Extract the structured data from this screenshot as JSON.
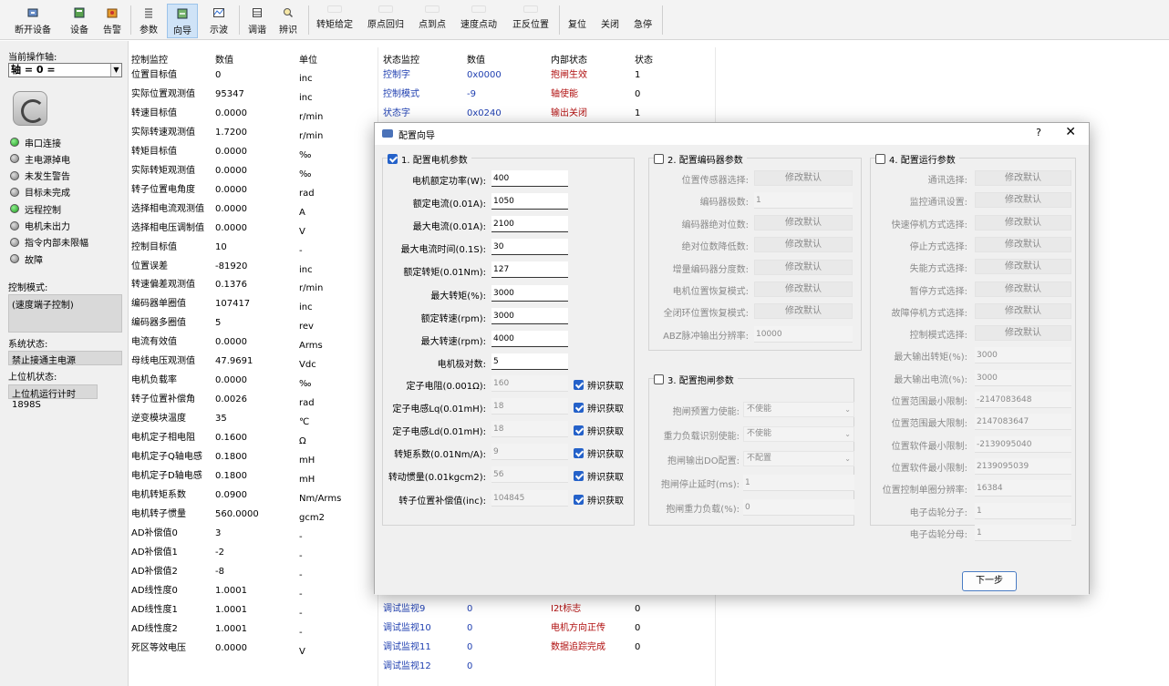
{
  "toolbar": {
    "items": [
      {
        "label": "断开设备"
      },
      {
        "label": "设备"
      },
      {
        "label": "告警"
      },
      {
        "label": "参数"
      },
      {
        "label": "向导"
      },
      {
        "label": "示波"
      },
      {
        "label": "调谐"
      },
      {
        "label": "辨识"
      },
      {
        "label": "转矩给定"
      },
      {
        "label": "原点回归"
      },
      {
        "label": "点到点"
      },
      {
        "label": "速度点动"
      },
      {
        "label": "正反位置"
      },
      {
        "label": "复位"
      },
      {
        "label": "关闭"
      },
      {
        "label": "急停"
      }
    ]
  },
  "left": {
    "current_axis_label": "当前操作轴:",
    "axis_value": "轴 = 0 =",
    "status": [
      {
        "label": "串口连接",
        "led": "green"
      },
      {
        "label": "主电源掉电",
        "led": "grey"
      },
      {
        "label": "未发生警告",
        "led": "grey"
      },
      {
        "label": "目标未完成",
        "led": "grey"
      },
      {
        "label": "远程控制",
        "led": "green"
      },
      {
        "label": "电机未出力",
        "led": "grey"
      },
      {
        "label": "指令内部未限幅",
        "led": "grey"
      },
      {
        "label": "故障",
        "led": "grey"
      }
    ],
    "control_mode_label": "控制模式:",
    "control_mode_value": "(速度端子控制)",
    "system_status_label": "系统状态:",
    "system_status_value": "禁止接通主电源",
    "host_status_label": "上位机状态:",
    "host_status_value": "上位机运行计时1898S"
  },
  "table1": {
    "headers": [
      "控制监控",
      "数值",
      "单位"
    ],
    "rows": [
      [
        "位置目标值",
        "0",
        "inc"
      ],
      [
        "实际位置观测值",
        "95347",
        "inc"
      ],
      [
        "转速目标值",
        "0.0000",
        "r/min"
      ],
      [
        "实际转速观测值",
        "1.7200",
        "r/min"
      ],
      [
        "转矩目标值",
        "0.0000",
        "‰"
      ],
      [
        "实际转矩观测值",
        "0.0000",
        "‰"
      ],
      [
        "转子位置电角度",
        "0.0000",
        "rad"
      ],
      [
        "选择相电流观测值",
        "0.0000",
        "A"
      ],
      [
        "选择相电压调制值",
        "0.0000",
        "V"
      ],
      [
        "控制目标值",
        "10",
        "-"
      ],
      [
        "位置误差",
        "-81920",
        "inc"
      ],
      [
        "转速偏差观测值",
        "0.1376",
        "r/min"
      ],
      [
        "编码器单圈值",
        "107417",
        "inc"
      ],
      [
        "编码器多圈值",
        "5",
        "rev"
      ],
      [
        "电流有效值",
        "0.0000",
        "Arms"
      ],
      [
        "母线电压观测值",
        "47.9691",
        "Vdc"
      ],
      [
        "电机负载率",
        "0.0000",
        "‰"
      ],
      [
        "转子位置补偿角",
        "0.0026",
        "rad"
      ],
      [
        "逆变模块温度",
        "35",
        "℃"
      ],
      [
        "电机定子相电阻",
        "0.1600",
        "Ω"
      ],
      [
        "电机定子Q轴电感",
        "0.1800",
        "mH"
      ],
      [
        "电机定子D轴电感",
        "0.1800",
        "mH"
      ],
      [
        "电机转矩系数",
        "0.0900",
        "Nm/Arms"
      ],
      [
        "电机转子惯量",
        "560.0000",
        "gcm2"
      ],
      [
        "AD补偿值0",
        "3",
        "-"
      ],
      [
        "AD补偿值1",
        "-2",
        "-"
      ],
      [
        "AD补偿值2",
        "-8",
        "-"
      ],
      [
        "AD线性度0",
        "1.0001",
        "-"
      ],
      [
        "AD线性度1",
        "1.0001",
        "-"
      ],
      [
        "AD线性度2",
        "1.0001",
        "-"
      ],
      [
        "死区等效电压",
        "0.0000",
        "V"
      ]
    ]
  },
  "table2": {
    "headers": [
      "状态监控",
      "数值",
      "内部状态",
      "状态"
    ],
    "rows_top": [
      [
        "控制字",
        "0x0000",
        "抱闸生效",
        "1"
      ],
      [
        "控制模式",
        "-9",
        "轴使能",
        "0"
      ],
      [
        "状态字",
        "0x0240",
        "输出关闭",
        "1"
      ]
    ],
    "rows_bottom": [
      [
        "调试监视9",
        "0",
        "I2t标志",
        "0"
      ],
      [
        "调试监视10",
        "0",
        "电机方向正传",
        "0"
      ],
      [
        "调试监视11",
        "0",
        "数据追踪完成",
        "0"
      ],
      [
        "调试监视12",
        "0",
        "",
        ""
      ]
    ]
  },
  "dialog": {
    "title": "配置向导",
    "help": "?",
    "close": "✕",
    "g1": {
      "title": "1. 配置电机参数",
      "fields": [
        {
          "label": "电机额定功率(W):",
          "value": "400"
        },
        {
          "label": "额定电流(0.01A):",
          "value": "1050"
        },
        {
          "label": "最大电流(0.01A):",
          "value": "2100"
        },
        {
          "label": "最大电流时间(0.1S):",
          "value": "30"
        },
        {
          "label": "额定转矩(0.01Nm):",
          "value": "127"
        },
        {
          "label": "最大转矩(%):",
          "value": "3000"
        },
        {
          "label": "额定转速(rpm):",
          "value": "3000"
        },
        {
          "label": "最大转速(rpm):",
          "value": "4000"
        },
        {
          "label": "电机极对数:",
          "value": "5"
        }
      ],
      "id_fields": [
        {
          "label": "定子电阻(0.001Ω):",
          "value": "160"
        },
        {
          "label": "定子电感Lq(0.01mH):",
          "value": "18"
        },
        {
          "label": "定子电感Ld(0.01mH):",
          "value": "18"
        },
        {
          "label": "转矩系数(0.01Nm/A):",
          "value": "9"
        },
        {
          "label": "转动惯量(0.01kgcm2):",
          "value": "56"
        },
        {
          "label": "转子位置补偿值(inc):",
          "value": "104845"
        }
      ],
      "auto_id_label": "辨识获取"
    },
    "g2": {
      "title": "2. 配置编码器参数",
      "rows": [
        {
          "label": "位置传感器选择:",
          "kind": "btn",
          "value": "修改默认"
        },
        {
          "label": "编码器极数:",
          "kind": "inp",
          "value": "1"
        },
        {
          "label": "编码器绝对位数:",
          "kind": "btn",
          "value": "修改默认"
        },
        {
          "label": "绝对位数降低数:",
          "kind": "btn",
          "value": "修改默认"
        },
        {
          "label": "增量编码器分度数:",
          "kind": "btn",
          "value": "修改默认"
        },
        {
          "label": "电机位置恢复模式:",
          "kind": "btn",
          "value": "修改默认"
        },
        {
          "label": "全闭环位置恢复模式:",
          "kind": "btn",
          "value": "修改默认"
        },
        {
          "label": "ABZ脉冲输出分辨率:",
          "kind": "inp",
          "value": "10000"
        }
      ]
    },
    "g3": {
      "title": "3. 配置抱闸参数",
      "rows": [
        {
          "label": "抱闸预置力使能:",
          "kind": "sel",
          "value": "不使能"
        },
        {
          "label": "重力负载识别使能:",
          "kind": "sel",
          "value": "不使能"
        },
        {
          "label": "抱闸输出DO配置:",
          "kind": "sel",
          "value": "不配置"
        },
        {
          "label": "抱闸停止延时(ms):",
          "kind": "inp",
          "value": "1"
        },
        {
          "label": "抱闸重力负载(%):",
          "kind": "inp",
          "value": "0"
        }
      ]
    },
    "g4": {
      "title": "4. 配置运行参数",
      "rows": [
        {
          "label": "通讯选择:",
          "kind": "btn",
          "value": "修改默认"
        },
        {
          "label": "监控通讯设置:",
          "kind": "btn",
          "value": "修改默认"
        },
        {
          "label": "快速停机方式选择:",
          "kind": "btn",
          "value": "修改默认"
        },
        {
          "label": "停止方式选择:",
          "kind": "btn",
          "value": "修改默认"
        },
        {
          "label": "失能方式选择:",
          "kind": "btn",
          "value": "修改默认"
        },
        {
          "label": "暂停方式选择:",
          "kind": "btn",
          "value": "修改默认"
        },
        {
          "label": "故障停机方式选择:",
          "kind": "btn",
          "value": "修改默认"
        },
        {
          "label": "控制模式选择:",
          "kind": "btn",
          "value": "修改默认"
        },
        {
          "label": "最大输出转矩(%):",
          "kind": "inp",
          "value": "3000"
        },
        {
          "label": "最大输出电流(%):",
          "kind": "inp",
          "value": "3000"
        },
        {
          "label": "位置范围最小限制:",
          "kind": "inp",
          "value": "-2147083648"
        },
        {
          "label": "位置范围最大限制:",
          "kind": "inp",
          "value": "2147083647"
        },
        {
          "label": "位置软件最小限制:",
          "kind": "inp",
          "value": "-2139095040"
        },
        {
          "label": "位置软件最小限制:",
          "kind": "inp",
          "value": "2139095039"
        },
        {
          "label": "位置控制单圈分辨率:",
          "kind": "inp",
          "value": "16384"
        },
        {
          "label": "电子齿轮分子:",
          "kind": "inp",
          "value": "1"
        },
        {
          "label": "电子齿轮分母:",
          "kind": "inp",
          "value": "1"
        }
      ]
    },
    "next_label": "下一步"
  }
}
